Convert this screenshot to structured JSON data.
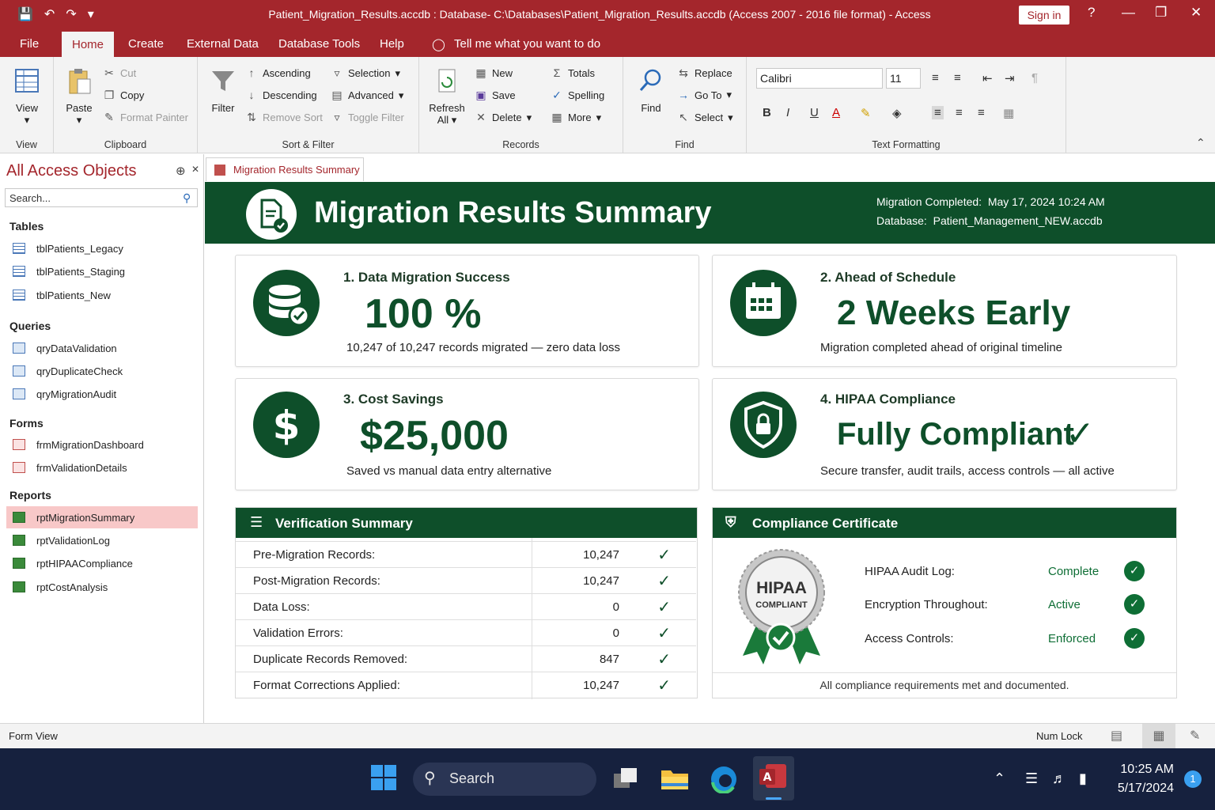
{
  "window": {
    "title": "Patient_Migration_Results.accdb : Database- C:\\Databases\\Patient_Migration_Results.accdb (Access 2007 - 2016 file format)  -  Access",
    "sign_in": "Sign in",
    "help": "?"
  },
  "tabs": [
    "File",
    "Home",
    "Create",
    "External Data",
    "Database Tools",
    "Help"
  ],
  "tell_me": "Tell me what you want to do",
  "ribbon": {
    "view": {
      "label": "View",
      "group": "View"
    },
    "clipboard": {
      "paste": "Paste",
      "cut": "Cut",
      "copy": "Copy",
      "format_painter": "Format Painter",
      "group": "Clipboard"
    },
    "sort_filter": {
      "filter": "Filter",
      "ascending": "Ascending",
      "descending": "Descending",
      "remove_sort": "Remove Sort",
      "selection": "Selection",
      "advanced": "Advanced",
      "toggle_filter": "Toggle Filter",
      "group": "Sort & Filter"
    },
    "records": {
      "refresh_line1": "Refresh",
      "refresh_line2": "All",
      "new": "New",
      "save": "Save",
      "delete": "Delete",
      "totals": "Totals",
      "spelling": "Spelling",
      "more": "More",
      "group": "Records"
    },
    "find": {
      "find": "Find",
      "replace": "Replace",
      "goto": "Go To",
      "select": "Select",
      "group": "Find"
    },
    "text_formatting": {
      "font": "Calibri",
      "size": "11",
      "bold": "B",
      "italic": "I",
      "underline": "U",
      "font_color": "A",
      "group": "Text Formatting"
    }
  },
  "nav": {
    "title": "All Access Objects",
    "search_placeholder": "Search...",
    "sections": {
      "tables": {
        "label": "Tables",
        "items": [
          "tblPatients_Legacy",
          "tblPatients_Staging",
          "tblPatients_New"
        ]
      },
      "queries": {
        "label": "Queries",
        "items": [
          "qryDataValidation",
          "qryDuplicateCheck",
          "qryMigrationAudit"
        ]
      },
      "forms": {
        "label": "Forms",
        "items": [
          "frmMigrationDashboard",
          "frmValidationDetails"
        ]
      },
      "reports": {
        "label": "Reports",
        "items": [
          "rptMigrationSummary",
          "rptValidationLog",
          "rptHIPAACompliance",
          "rptCostAnalysis"
        ]
      }
    }
  },
  "doc_tab": "Migration Results Summary",
  "report": {
    "title": "Migration Results Summary",
    "completed_label": "Migration Completed:",
    "completed_value": "May 17, 2024 10:24 AM",
    "database_label": "Database:",
    "database_value": "Patient_Management_NEW.accdb",
    "cards": [
      {
        "title": "1. Data Migration Success",
        "big": "100 %",
        "sub": "10,247 of 10,247 records migrated — zero data loss"
      },
      {
        "title": "2. Ahead of Schedule",
        "big": "2 Weeks Early",
        "sub": "Migration completed ahead of original timeline"
      },
      {
        "title": "3. Cost Savings",
        "big": "$25,000",
        "sub": "Saved vs manual data entry alternative"
      },
      {
        "title": "4. HIPAA Compliance",
        "big": "Fully Compliant",
        "sub": "Secure transfer, audit trails, access controls — all active"
      }
    ],
    "verification": {
      "title": "Verification Summary",
      "rows": [
        {
          "label": "Pre-Migration Records:",
          "value": "10,247"
        },
        {
          "label": "Post-Migration Records:",
          "value": "10,247"
        },
        {
          "label": "Data Loss:",
          "value": "0"
        },
        {
          "label": "Validation Errors:",
          "value": "0"
        },
        {
          "label": "Duplicate Records Removed:",
          "value": "847"
        },
        {
          "label": "Format Corrections Applied:",
          "value": "10,247"
        }
      ]
    },
    "certificate": {
      "title": "Compliance Certificate",
      "seal_line1": "HIPAA",
      "seal_line2": "COMPLIANT",
      "rows": [
        {
          "label": "HIPAA Audit Log:",
          "value": "Complete"
        },
        {
          "label": "Encryption Throughout:",
          "value": "Active"
        },
        {
          "label": "Access Controls:",
          "value": "Enforced"
        }
      ],
      "footer": "All compliance requirements met and documented."
    }
  },
  "status": {
    "left": "Form View",
    "num_lock": "Num Lock"
  },
  "taskbar": {
    "search": "Search",
    "time": "10:25 AM",
    "date": "5/17/2024",
    "notifications": "1"
  },
  "colors": {
    "access_red": "#a4262c",
    "report_green": "#0e4f2a",
    "check_green": "#0e6e35"
  }
}
